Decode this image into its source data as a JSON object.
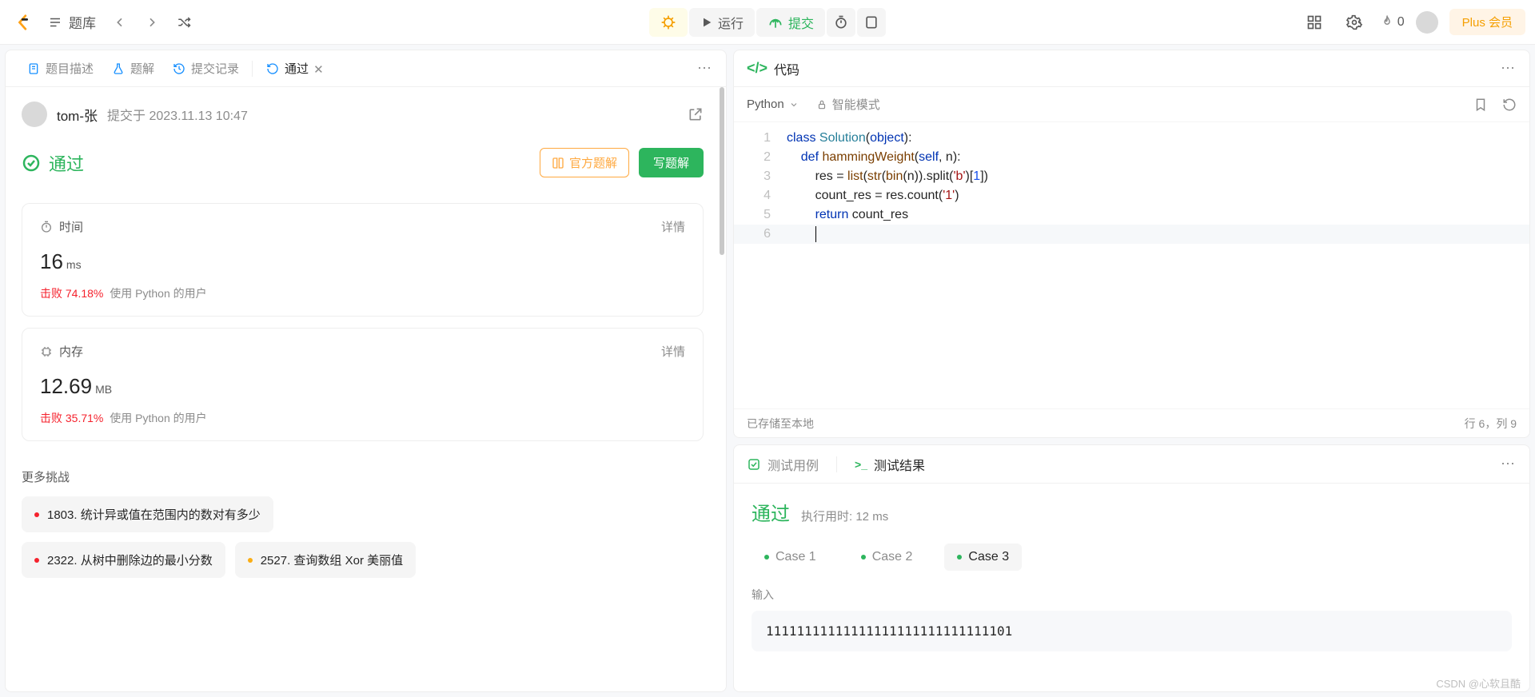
{
  "topbar": {
    "problems_label": "题库",
    "run_label": "运行",
    "submit_label": "提交",
    "fire_count": "0",
    "plus_label": "Plus 会员"
  },
  "left": {
    "tabs": {
      "desc": "题目描述",
      "solution": "题解",
      "history": "提交记录",
      "pass": "通过"
    },
    "user": "tom-张",
    "submit_prefix": "提交于",
    "submit_time": "2023.11.13 10:47",
    "status": "通过",
    "official_btn": "官方题解",
    "write_btn": "写题解",
    "time": {
      "label": "时间",
      "detail": "详情",
      "value": "16",
      "unit": "ms",
      "beat_label": "击败",
      "beat_pct": "74.18%",
      "beat_rest": "使用 Python 的用户"
    },
    "memory": {
      "label": "内存",
      "detail": "详情",
      "value": "12.69",
      "unit": "MB",
      "beat_label": "击败",
      "beat_pct": "35.71%",
      "beat_rest": "使用 Python 的用户"
    },
    "challenge_title": "更多挑战",
    "chips": [
      "1803. 统计异或值在范围内的数对有多少",
      "2322. 从树中删除边的最小分数",
      "2527. 查询数组 Xor 美丽值"
    ]
  },
  "code": {
    "title": "代码",
    "language": "Python",
    "mode": "智能模式",
    "lines": [
      {
        "n": "1",
        "indent": "",
        "tokens": [
          [
            "kw",
            "class"
          ],
          [
            "",
            " "
          ],
          [
            "cls",
            "Solution"
          ],
          [
            "",
            "("
          ],
          [
            "bl",
            "object"
          ],
          [
            "",
            "):"
          ]
        ]
      },
      {
        "n": "2",
        "indent": "    ",
        "tokens": [
          [
            "kw",
            "def"
          ],
          [
            "",
            " "
          ],
          [
            "fn",
            "hammingWeight"
          ],
          [
            "",
            "("
          ],
          [
            "bl",
            "self"
          ],
          [
            "",
            ", n):"
          ]
        ]
      },
      {
        "n": "3",
        "indent": "        ",
        "tokens": [
          [
            "",
            "res = "
          ],
          [
            "fn",
            "list"
          ],
          [
            "",
            "("
          ],
          [
            "fn",
            "str"
          ],
          [
            "",
            "("
          ],
          [
            "fn",
            "bin"
          ],
          [
            "",
            "(n)).split("
          ],
          [
            "str",
            "'b'"
          ],
          [
            "",
            ")["
          ],
          [
            "num",
            "1"
          ],
          [
            "",
            "])"
          ]
        ]
      },
      {
        "n": "4",
        "indent": "        ",
        "tokens": [
          [
            "",
            "count_res = res.count("
          ],
          [
            "str",
            "'1'"
          ],
          [
            "",
            ")"
          ]
        ]
      },
      {
        "n": "5",
        "indent": "        ",
        "tokens": [
          [
            "kw",
            "return"
          ],
          [
            "",
            " count_res"
          ]
        ]
      },
      {
        "n": "6",
        "indent": "        ",
        "tokens": []
      }
    ],
    "saved": "已存储至本地",
    "pos": "行 6，列 9"
  },
  "result": {
    "tab_cases": "测试用例",
    "tab_result": "测试结果",
    "pass": "通过",
    "exec_label": "执行用时:",
    "exec_value": "12 ms",
    "cases": [
      "Case 1",
      "Case 2",
      "Case 3"
    ],
    "input_label": "输入",
    "input_value": "11111111111111111111111111111101"
  },
  "watermark": "CSDN @心软且酷"
}
